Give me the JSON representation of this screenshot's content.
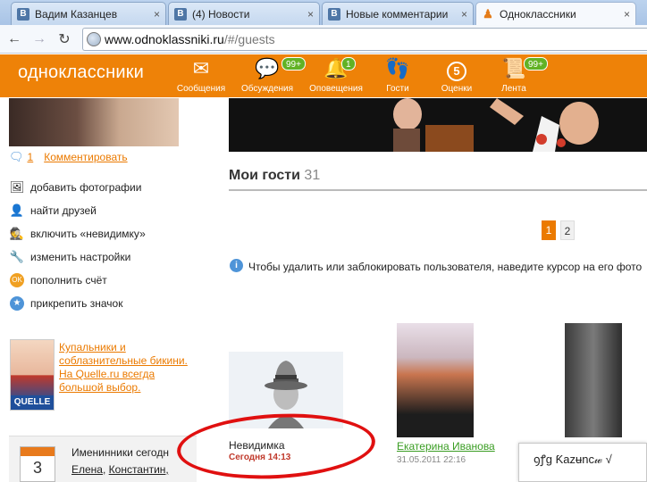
{
  "browser": {
    "tabs": [
      {
        "icon": "В",
        "title": "Вадим Казанцев",
        "close": "×"
      },
      {
        "icon": "В",
        "title": "(4) Новости",
        "close": "×"
      },
      {
        "icon": "В",
        "title": "Новые комментарии",
        "close": "×"
      },
      {
        "icon": "ok",
        "title": "Одноклассники",
        "close": "×"
      }
    ],
    "url_host": "www.odnoklassniki.ru",
    "url_path": "/#/guests"
  },
  "header": {
    "logo": "одноклассники",
    "nav": [
      {
        "label": "Сообщения",
        "icon": "envelope-icon",
        "badge": ""
      },
      {
        "label": "Обсуждения",
        "icon": "speech-bubbles-icon",
        "badge": "99+"
      },
      {
        "label": "Оповещения",
        "icon": "bell-icon",
        "badge": "1"
      },
      {
        "label": "Гости",
        "icon": "footprints-icon",
        "badge": ""
      },
      {
        "label": "Оценки",
        "icon": "rating-5-icon",
        "badge": "",
        "glyph": "5"
      },
      {
        "label": "Лента",
        "icon": "feed-icon",
        "badge": "99+"
      }
    ],
    "accent": "#ee8208"
  },
  "left": {
    "comment_count": "1",
    "comment_link": "Комментировать",
    "menu": [
      {
        "label": "добавить фотографии",
        "icon": "add-photo-icon"
      },
      {
        "label": "найти друзей",
        "icon": "find-friends-icon"
      },
      {
        "label": "включить «невидимку»",
        "icon": "invisible-icon"
      },
      {
        "label": "изменить настройки",
        "icon": "wrench-icon"
      },
      {
        "label": "пополнить счёт",
        "icon": "ok-coin-icon"
      },
      {
        "label": "прикрепить значок",
        "icon": "badge-star-icon"
      }
    ],
    "ad": {
      "lines": [
        "Купальники и",
        "соблазнительные бикини.",
        "На Quelle.ru всегда",
        "большой выбор."
      ],
      "logo": "QUELLE"
    },
    "birthdays": {
      "title": "Именинники сегодн",
      "day": "3",
      "names": [
        "Елена",
        "Константин,"
      ]
    }
  },
  "main": {
    "title": "Мои гости",
    "count": "31",
    "pages": [
      "1",
      "2"
    ],
    "info": "Чтобы удалить или заблокировать пользователя, наведите курсор на его фото",
    "guests": [
      {
        "name": "Невидимка",
        "date": "Сегодня 14:13"
      },
      {
        "name": "Екатерина Иванова",
        "date": "31.05.2011 22:16"
      },
      {
        "name": "",
        "date": ""
      }
    ]
  },
  "popup": {
    "text": "ꝯꝭg Ƙazʉnc𝓌 √"
  }
}
